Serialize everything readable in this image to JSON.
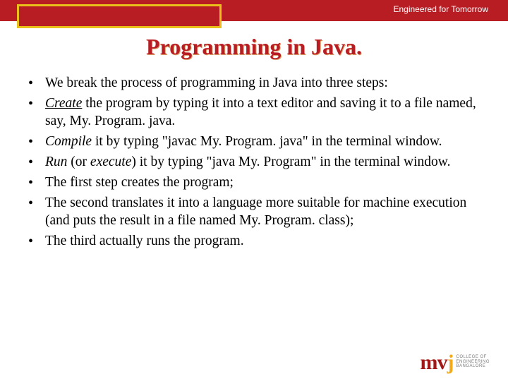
{
  "header": {
    "tagline": "Engineered for Tomorrow"
  },
  "title": "Programming in Java.",
  "bullets": [
    {
      "html": "We break the process of programming in Java into three steps:"
    },
    {
      "html": "<span class='iu'>Create</span> the program by typing it into a text editor and saving it to a file named, say, My. Program. java."
    },
    {
      "html": "<span class='i'>Compile</span> it by typing \"javac My. Program. java\" in the terminal window."
    },
    {
      "html": "<span class='i'>Run</span> (or <span class='i'>execute</span>) it by typing \"java My. Program\" in the terminal window."
    },
    {
      "html": "The first step creates the program;"
    },
    {
      "html": "The second translates it into a language more suitable for machine execution (and puts the result in a file named My. Program. class);"
    },
    {
      "html": "The third actually runs the program."
    }
  ],
  "logo": {
    "mark_left": "m",
    "mark_mid": "v",
    "mark_right": "j",
    "line1": "COLLEGE OF",
    "line2": "ENGINEERING",
    "line3": "BANGALORE"
  }
}
